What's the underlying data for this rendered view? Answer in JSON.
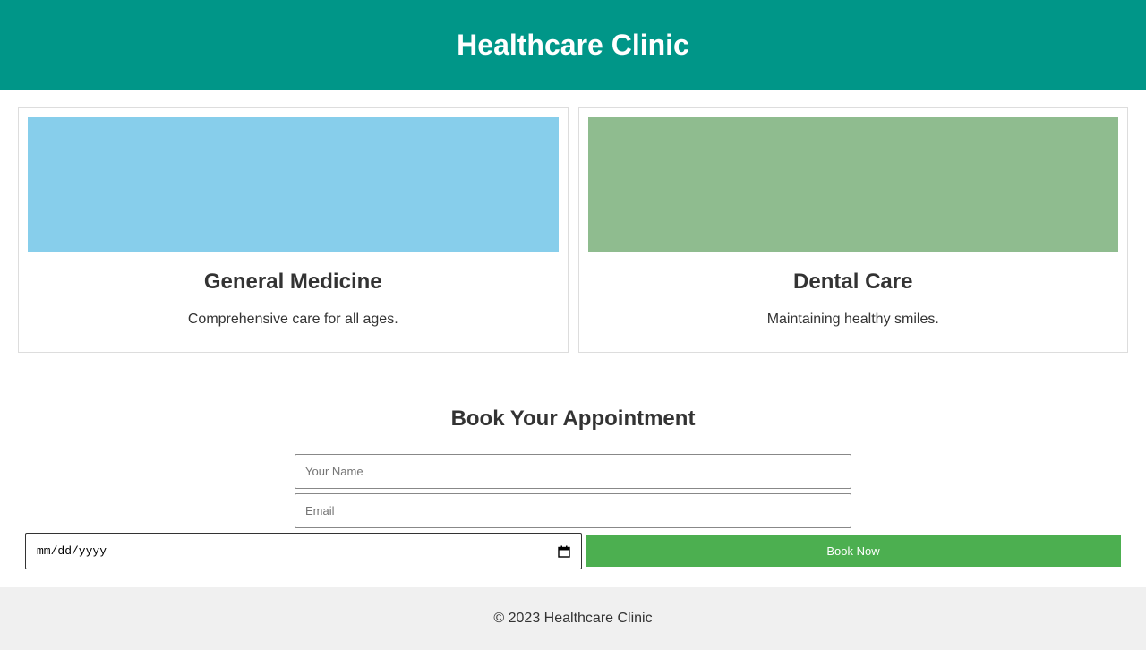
{
  "header": {
    "title": "Healthcare Clinic"
  },
  "colors": {
    "header_bg": "#009688",
    "general_image": "#87CEEB",
    "dental_image": "#8FBC8F",
    "button_bg": "#4CAF50",
    "footer_bg": "#F0F0F0"
  },
  "services": [
    {
      "title": "General Medicine",
      "description": "Comprehensive care for all ages."
    },
    {
      "title": "Dental Care",
      "description": "Maintaining healthy smiles."
    }
  ],
  "booking": {
    "title": "Book Your Appointment",
    "name_placeholder": "Your Name",
    "email_placeholder": "Email",
    "date_placeholder": "mm/dd/yyyy",
    "date_icon": "calendar-icon",
    "submit_label": "Book Now"
  },
  "footer": {
    "text": "© 2023 Healthcare Clinic"
  }
}
